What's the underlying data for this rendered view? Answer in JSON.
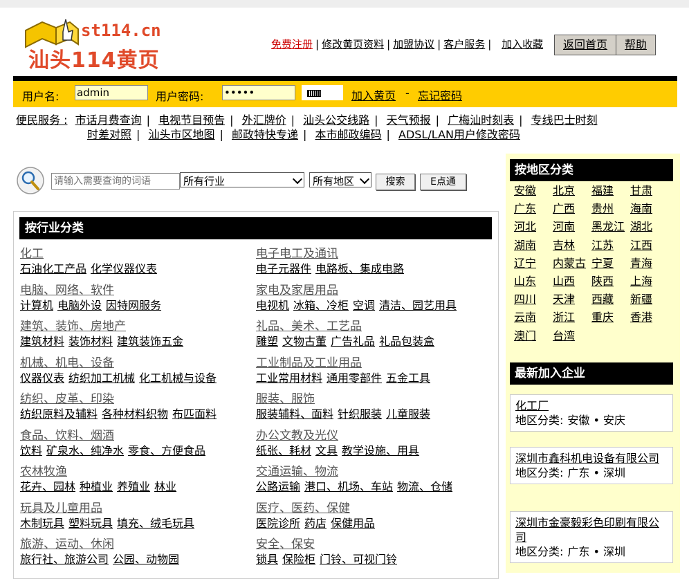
{
  "logo": {
    "brand": "st114.cn",
    "name": "汕头114黄页"
  },
  "top_links": [
    "免费注册",
    "修改黄页资料",
    "加盟协议",
    "客户服务",
    "加入收藏"
  ],
  "top_buttons": {
    "home": "返回首页",
    "help": "帮助"
  },
  "login": {
    "username_label": "用户名:",
    "username_value": "admin",
    "password_label": "用户密码:",
    "password_value": "•••••",
    "join_link": "加入黄页",
    "separator": "-",
    "forgot_link": "忘记密码"
  },
  "services": {
    "label": "便民服务 :",
    "row1": [
      "市话月费查询",
      "电视节目预告",
      "外汇牌价",
      "汕头公交线路",
      "天气预报",
      "广梅汕时刻表",
      "专线巴士时刻"
    ],
    "row2": [
      "时差对照",
      "汕头市区地图",
      "邮政特快专递",
      "本市邮政编码",
      "ADSL/LAN用户修改密码"
    ]
  },
  "search": {
    "placeholder": "请输入需要查询的词语",
    "industry_selected": "所有行业",
    "region_selected": "所有地区",
    "search_button": "搜索",
    "e_button": "E点通"
  },
  "industry": {
    "heading": "按行业分类",
    "categories": [
      {
        "title": "化工",
        "subs": [
          "石油化工产品",
          "化学仪器仪表"
        ]
      },
      {
        "title": "电子电工及通讯",
        "subs": [
          "电子元器件",
          "电路板、集成电路"
        ]
      },
      {
        "title": "电脑、网络、软件",
        "subs": [
          "计算机",
          "电脑外设",
          "因特网服务"
        ]
      },
      {
        "title": "家电及家居用品",
        "subs": [
          "电视机",
          "冰箱、冷柜",
          "空调",
          "清洁、园艺用具"
        ]
      },
      {
        "title": "建筑、装饰、房地产",
        "subs": [
          "建筑材料",
          "装饰材料",
          "建筑装饰五金"
        ]
      },
      {
        "title": "礼品、美术、工艺品",
        "subs": [
          "雕塑",
          "文物古董",
          "广告礼品",
          "礼品包装盒"
        ]
      },
      {
        "title": "机械、机电、设备",
        "subs": [
          "仪器仪表",
          "纺织加工机械",
          "化工机械与设备"
        ]
      },
      {
        "title": "工业制品及工业用品",
        "subs": [
          "工业常用材料",
          "通用零部件",
          "五金工具"
        ]
      },
      {
        "title": "纺织、皮革、印染",
        "subs": [
          "纺织原料及辅料",
          "各种材料织物",
          "布匹面料"
        ]
      },
      {
        "title": "服装、服饰",
        "subs": [
          "服装辅料、面料",
          "针织服装",
          "儿童服装"
        ]
      },
      {
        "title": "食品、饮料、烟酒",
        "subs": [
          "饮料",
          "矿泉水、纯净水",
          "零食、方便食品"
        ]
      },
      {
        "title": "办公文教及光仪",
        "subs": [
          "纸张、耗材",
          "文具",
          "教学设施、用具"
        ]
      },
      {
        "title": "农林牧渔",
        "subs": [
          "花卉、园林",
          "种植业",
          "养殖业",
          "林业"
        ]
      },
      {
        "title": "交通运输、物流",
        "subs": [
          "公路运输",
          "港口、机场、车站",
          "物流、仓储"
        ]
      },
      {
        "title": "玩具及儿童用品",
        "subs": [
          "木制玩具",
          "塑料玩具",
          "填充、绒毛玩具"
        ]
      },
      {
        "title": "医疗、医药、保健",
        "subs": [
          "医院诊所",
          "药店",
          "保健用品"
        ]
      },
      {
        "title": "旅游、运动、休闲",
        "subs": [
          "旅行社、旅游公司",
          "公园、动物园"
        ]
      },
      {
        "title": "安全、保安",
        "subs": [
          "锁具",
          "保险柜",
          "门铃、可视门铃"
        ]
      }
    ]
  },
  "regions": {
    "heading": "按地区分类",
    "items": [
      "安徽",
      "北京",
      "福建",
      "甘肃",
      "广东",
      "广西",
      "贵州",
      "海南",
      "河北",
      "河南",
      "黑龙江",
      "湖北",
      "湖南",
      "吉林",
      "江苏",
      "江西",
      "辽宁",
      "内蒙古",
      "宁夏",
      "青海",
      "山东",
      "山西",
      "陕西",
      "上海",
      "四川",
      "天津",
      "西藏",
      "新疆",
      "云南",
      "浙江",
      "重庆",
      "香港",
      "澳门",
      "台湾"
    ]
  },
  "latest": {
    "heading": "最新加入企业",
    "region_label": "地区分类:",
    "companies": [
      {
        "name": "化工厂",
        "region": "安徽 • 安庆"
      },
      {
        "name": "深圳市鑫科机电设备有限公司",
        "region": "广东 • 深圳"
      },
      {
        "name": "深圳市金豪毅彩色印刷有限公司",
        "region": "广东 • 深圳"
      }
    ]
  },
  "colors": {
    "login_bar": "#ffcc00",
    "sidebar_bg": "#ffffcc",
    "register_link": "#cc0000",
    "category_title": "#555555"
  }
}
